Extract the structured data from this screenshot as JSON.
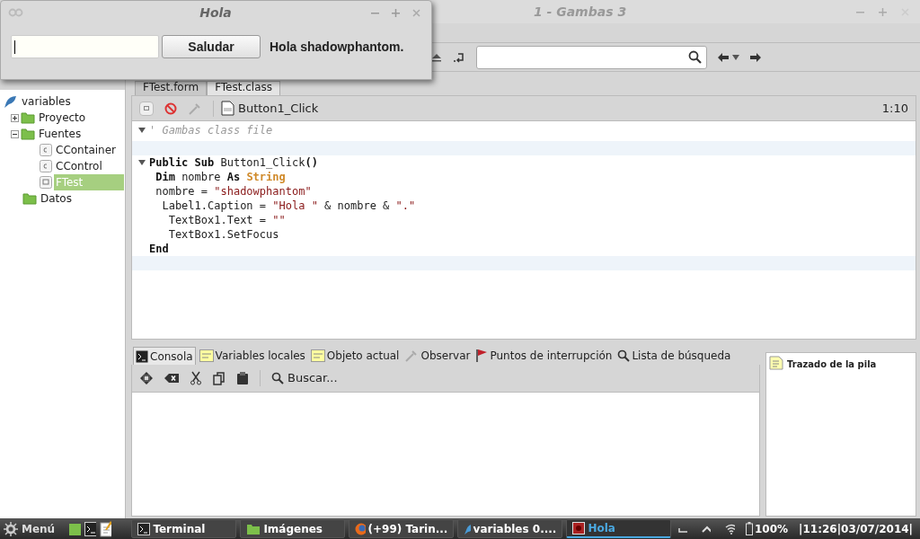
{
  "main_window": {
    "title": "1 - Gambas 3"
  },
  "dialog": {
    "title": "Hola",
    "button": "Saludar",
    "label": "Hola shadowphantom."
  },
  "project_tree": [
    {
      "label": "variables",
      "kind": "project",
      "children": [
        {
          "label": "Proyecto",
          "kind": "folder",
          "expanded": false,
          "selected": false
        },
        {
          "label": "Fuentes",
          "kind": "folder",
          "expanded": true,
          "selected": false,
          "children": [
            {
              "label": "CContainer",
              "kind": "class",
              "selected": false
            },
            {
              "label": "CControl",
              "kind": "class",
              "selected": false
            },
            {
              "label": "FTest",
              "kind": "form",
              "selected": true
            }
          ]
        },
        {
          "label": "Datos",
          "kind": "folder",
          "selected": false
        }
      ]
    }
  ],
  "editor_tabs": [
    {
      "label": "FTest.form",
      "selected": false
    },
    {
      "label": "FTest.class",
      "selected": true
    }
  ],
  "editor": {
    "procedure": "Button1_Click",
    "position": "1:10",
    "lines": [
      [
        {
          "kind": "comment",
          "text": "' Gambas class file"
        }
      ],
      [
        {
          "kind": "keyword",
          "text": "Public Sub"
        },
        {
          "kind": "plain",
          "text": " Button1_Click"
        },
        {
          "kind": "keyword",
          "text": "()"
        }
      ],
      [
        {
          "kind": "keyword",
          "text": " Dim"
        },
        {
          "kind": "plain",
          "text": " nombre "
        },
        {
          "kind": "keyword",
          "text": "As"
        },
        {
          "kind": "type",
          "text": " String"
        }
      ],
      [
        {
          "kind": "plain",
          "text": " nombre = "
        },
        {
          "kind": "string",
          "text": "\"shadowphantom\""
        }
      ],
      [
        {
          "kind": "plain",
          "text": "  Label1.Caption = "
        },
        {
          "kind": "string",
          "text": "\"Hola \""
        },
        {
          "kind": "plain",
          "text": " & nombre & "
        },
        {
          "kind": "string",
          "text": "\".\""
        }
      ],
      [
        {
          "kind": "plain",
          "text": "   TextBox1.Text = "
        },
        {
          "kind": "string",
          "text": "\"\""
        }
      ],
      [
        {
          "kind": "plain",
          "text": "   TextBox1.SetFocus"
        }
      ],
      [
        {
          "kind": "keyword",
          "text": "End"
        }
      ]
    ]
  },
  "bottom_tabs": [
    {
      "label": "Consola",
      "selected": true
    },
    {
      "label": "Variables locales",
      "selected": false
    },
    {
      "label": "Objeto actual",
      "selected": false
    },
    {
      "label": "Observar",
      "selected": false
    },
    {
      "label": "Puntos de interrupción",
      "selected": false
    },
    {
      "label": "Lista de búsqueda",
      "selected": false
    }
  ],
  "console_toolbar": {
    "search": "Buscar..."
  },
  "stack_panel": {
    "title": "Trazado de la pila"
  },
  "taskbar": {
    "menu": "Menú",
    "tasks": [
      {
        "label": "Terminal",
        "selected": false
      },
      {
        "label": "Imágenes",
        "selected": false
      },
      {
        "label": "(+99) Tarin...",
        "selected": false
      },
      {
        "label": "variables 0....",
        "selected": false
      },
      {
        "label": "Hola",
        "selected": true
      }
    ],
    "battery": "100%",
    "clock": "|11:26|03/07/2014|"
  }
}
